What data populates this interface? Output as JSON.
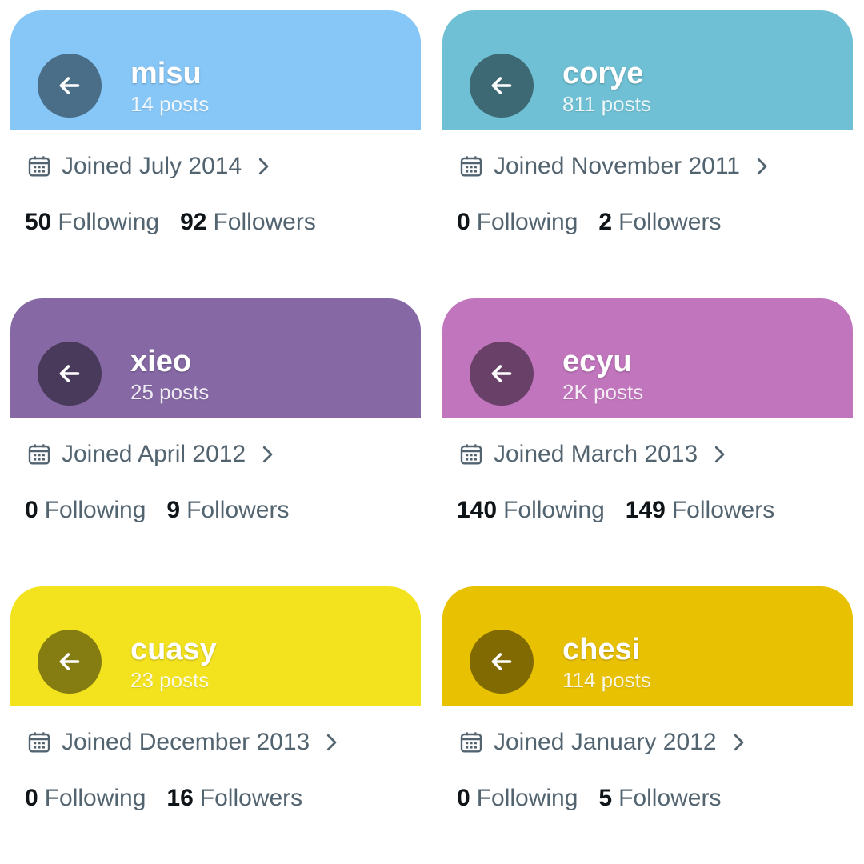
{
  "profiles": [
    {
      "name": "misu",
      "posts": "14 posts",
      "joined": "Joined July 2014",
      "following": "50",
      "following_label": "Following",
      "followers": "92",
      "followers_label": "Followers",
      "color": "#87c7f7"
    },
    {
      "name": "corye",
      "posts": "811 posts",
      "joined": "Joined November 2011",
      "following": "0",
      "following_label": "Following",
      "followers": "2",
      "followers_label": "Followers",
      "color": "#6fc0d4"
    },
    {
      "name": "xieo",
      "posts": "25 posts",
      "joined": "Joined April 2012",
      "following": "0",
      "following_label": "Following",
      "followers": "9",
      "followers_label": "Followers",
      "color": "#8568a4"
    },
    {
      "name": "ecyu",
      "posts": "2K posts",
      "joined": "Joined March 2013",
      "following": "140",
      "following_label": "Following",
      "followers": "149",
      "followers_label": "Followers",
      "color": "#c075bc"
    },
    {
      "name": "cuasy",
      "posts": "23 posts",
      "joined": "Joined December 2013",
      "following": "0",
      "following_label": "Following",
      "followers": "16",
      "followers_label": "Followers",
      "color": "#f3e31f"
    },
    {
      "name": "chesi",
      "posts": "114 posts",
      "joined": "Joined January 2012",
      "following": "0",
      "following_label": "Following",
      "followers": "5",
      "followers_label": "Followers",
      "color": "#e9c103"
    }
  ],
  "icons": {
    "back": "arrow-left-icon",
    "calendar": "calendar-icon",
    "chevron": "chevron-right-icon"
  }
}
